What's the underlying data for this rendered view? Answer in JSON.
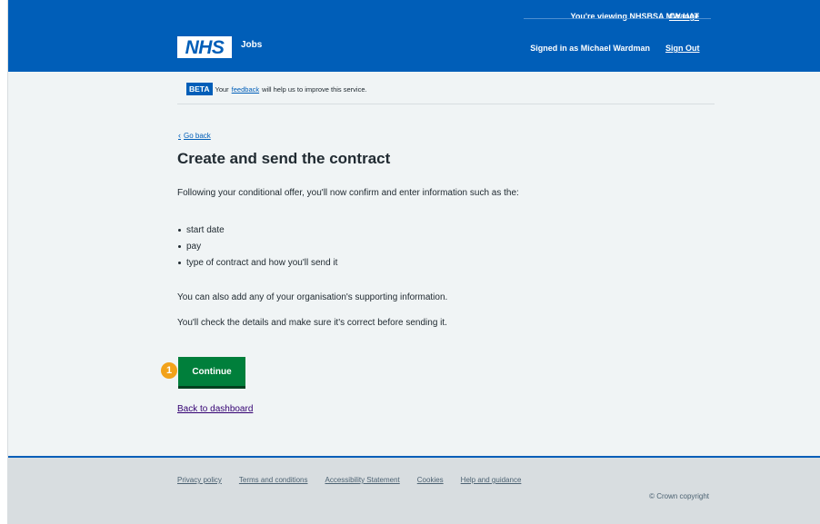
{
  "header": {
    "viewing_prefix": "You're viewing ",
    "org_name": "NHSBSA MW UAT",
    "change_label": "Change",
    "logo_text": "NHS",
    "service_name": "Jobs",
    "signed_in_text": "Signed in as Michael Wardman",
    "sign_out_label": "Sign Out"
  },
  "beta_banner": {
    "tag": "BETA",
    "text_before": "Your",
    "link": "feedback",
    "text_after": "will help us to improve this service."
  },
  "main": {
    "back_label": "Go back",
    "title": "Create and send the contract",
    "lead": "Following your conditional offer, you'll now confirm and enter information such as the:",
    "list_items": [
      "start date",
      "pay",
      "type of contract and how you'll send it"
    ],
    "para_supporting": "You can also add any of your organisation's supporting information.",
    "para_check": "You'll check the details and make sure it's correct before sending it.",
    "step_number": "1",
    "continue_label": "Continue",
    "dashboard_link": "Back to dashboard"
  },
  "footer": {
    "links": [
      "Privacy policy",
      "Terms and conditions",
      "Accessibility Statement",
      "Cookies",
      "Help and guidance"
    ],
    "copyright": "© Crown copyright"
  },
  "colors": {
    "nhs_blue": "#005eb8",
    "button_green": "#007f3b",
    "step_badge": "#f2a21a",
    "background": "#f0f4f5",
    "footer_bg": "#d8dde0"
  },
  "icons": {
    "back": "chevron-left-icon"
  }
}
